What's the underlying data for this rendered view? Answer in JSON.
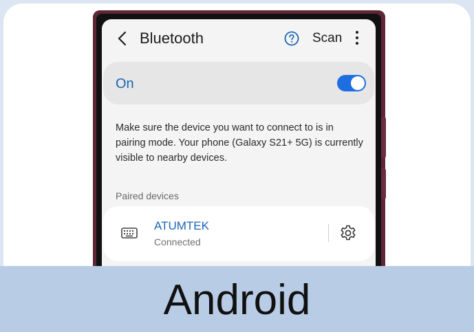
{
  "header": {
    "title": "Bluetooth",
    "scan_label": "Scan"
  },
  "bluetooth_toggle": {
    "label": "On",
    "enabled": true
  },
  "description": "Make sure the device you want to connect to is in pairing mode. Your phone (Galaxy S21+ 5G) is currently visible to nearby devices.",
  "paired_devices": {
    "section_label": "Paired devices",
    "items": [
      {
        "name": "ATUMTEK",
        "status": "Connected",
        "icon": "keyboard-icon"
      }
    ]
  },
  "banner": {
    "label": "Android"
  },
  "colors": {
    "accent": "#1a64b7",
    "toggle_on": "#1d6ee0",
    "phone_frame": "#5e2636",
    "banner_bg": "#b8cce6"
  }
}
